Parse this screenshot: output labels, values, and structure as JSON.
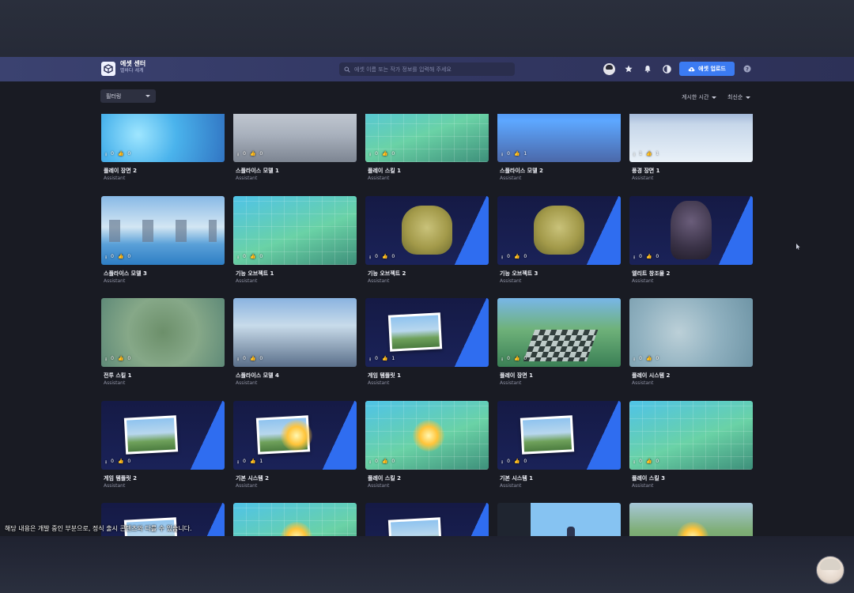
{
  "header": {
    "brand_title": "에셋 센터",
    "brand_subtitle": "별바다 세계",
    "search_placeholder": "에셋 이름 또는 작가 정보를 입력해 주세요",
    "upload_label": "에셋 업로드"
  },
  "toolbar": {
    "filter_label": "필터링",
    "sort_time_label": "게시한 시간",
    "sort_order_label": "최신순"
  },
  "cards": [
    {
      "title": "플레이 장면 2",
      "author": "Assistant",
      "downloads": "0",
      "likes": "0",
      "thumb": "th-ice"
    },
    {
      "title": "스플라이스 모델 1",
      "author": "Assistant",
      "downloads": "0",
      "likes": "0",
      "thumb": "th-grey"
    },
    {
      "title": "플레이 스킬 1",
      "author": "Assistant",
      "downloads": "0",
      "likes": "0",
      "thumb": "th-tiles"
    },
    {
      "title": "스플라이스 모델 2",
      "author": "Assistant",
      "downloads": "0",
      "likes": "1",
      "thumb": "th-blue-field"
    },
    {
      "title": "풍경 장면 1",
      "author": "Assistant",
      "downloads": "1",
      "likes": "1",
      "thumb": "th-snow"
    },
    {
      "title": "스플라이스 모델 3",
      "author": "Assistant",
      "downloads": "0",
      "likes": "0",
      "thumb": "th-sky"
    },
    {
      "title": "기능 오브젝트 1",
      "author": "Assistant",
      "downloads": "0",
      "likes": "0",
      "thumb": "th-tiles"
    },
    {
      "title": "기능 오브젝트 2",
      "author": "Assistant",
      "downloads": "0",
      "likes": "0",
      "thumb": "th-navy",
      "overlay": "tree"
    },
    {
      "title": "기능 오브젝트 3",
      "author": "Assistant",
      "downloads": "0",
      "likes": "0",
      "thumb": "th-navy",
      "overlay": "tree"
    },
    {
      "title": "엘리트 창조물 2",
      "author": "Assistant",
      "downloads": "0",
      "likes": "0",
      "thumb": "th-navy",
      "overlay": "monster"
    },
    {
      "title": "전투 스킬 1",
      "author": "Assistant",
      "downloads": "0",
      "likes": "0",
      "thumb": "th-green"
    },
    {
      "title": "스플라이스 모델 4",
      "author": "Assistant",
      "downloads": "0",
      "likes": "0",
      "thumb": "th-town"
    },
    {
      "title": "게임 템플릿 1",
      "author": "Assistant",
      "downloads": "0",
      "likes": "1",
      "thumb": "th-navy",
      "overlay": "photo"
    },
    {
      "title": "플레이 장면 1",
      "author": "Assistant",
      "downloads": "0",
      "likes": "0",
      "thumb": "th-checker-wrap"
    },
    {
      "title": "플레이 시스템 2",
      "author": "Assistant",
      "downloads": "0",
      "likes": "0",
      "thumb": "th-plaza"
    },
    {
      "title": "게임 템플릿 2",
      "author": "Assistant",
      "downloads": "0",
      "likes": "0",
      "thumb": "th-navy",
      "overlay": "photo"
    },
    {
      "title": "기본 시스템 2",
      "author": "Assistant",
      "downloads": "0",
      "likes": "1",
      "thumb": "th-navy",
      "overlay": "photo-burst"
    },
    {
      "title": "플레이 스킬 2",
      "author": "Assistant",
      "downloads": "0",
      "likes": "0",
      "thumb": "th-tiles",
      "overlay": "burst"
    },
    {
      "title": "기본 시스템 1",
      "author": "Assistant",
      "downloads": "0",
      "likes": "0",
      "thumb": "th-navy",
      "overlay": "photo"
    },
    {
      "title": "플레이 스킬 3",
      "author": "Assistant",
      "downloads": "0",
      "likes": "0",
      "thumb": "th-tiles"
    },
    {
      "title": "",
      "author": "",
      "downloads": "",
      "likes": "",
      "thumb": "th-navy",
      "overlay": "photo"
    },
    {
      "title": "",
      "author": "",
      "downloads": "",
      "likes": "",
      "thumb": "th-tiles",
      "overlay": "burst"
    },
    {
      "title": "",
      "author": "",
      "downloads": "",
      "likes": "",
      "thumb": "th-navy",
      "overlay": "photo"
    },
    {
      "title": "",
      "author": "",
      "downloads": "",
      "likes": "",
      "thumb": "th-editor",
      "overlay": "figure"
    },
    {
      "title": "",
      "author": "",
      "downloads": "",
      "likes": "",
      "thumb": "th-pitch",
      "overlay": "burst"
    }
  ],
  "subtitle": "해당 내용은 개발 중인 부분으로, 정식 출시 콘텐츠와 다를 수 있습니다.",
  "icons": [
    "cube-logo-icon",
    "search-icon",
    "star-icon",
    "bell-icon",
    "theme-icon",
    "cloud-upload-icon",
    "help-icon",
    "download-icon",
    "like-icon",
    "caret-down-icon"
  ],
  "colors": {
    "accent": "#3b7bf2",
    "header": "#363b68",
    "page_bg": "#191b23"
  }
}
